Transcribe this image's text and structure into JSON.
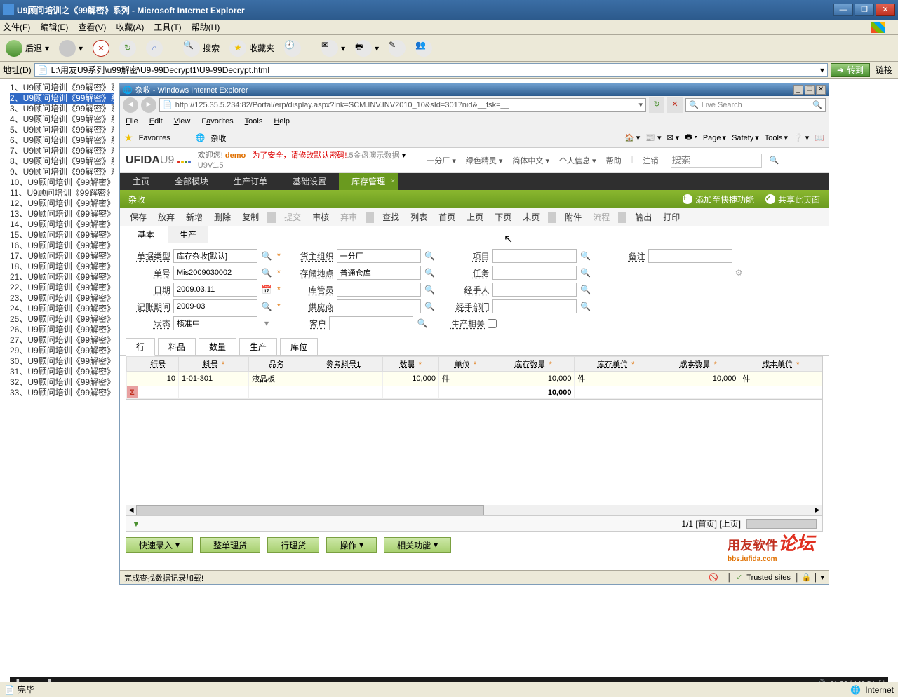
{
  "outer": {
    "title": "U9顾问培训之《99解密》系列 - Microsoft Internet Explorer",
    "menu": [
      "文件(F)",
      "编辑(E)",
      "查看(V)",
      "收藏(A)",
      "工具(T)",
      "帮助(H)"
    ],
    "back": "后退",
    "search": "搜索",
    "favorites": "收藏夹",
    "addr_label": "地址(D)",
    "addr": "L:\\用友U9系列\\u99解密\\U9-99Decrypt1\\U9-99Decrypt.html",
    "go": "转到",
    "links": "链接",
    "status": "完毕",
    "zone": "Internet"
  },
  "sidebar_template": "U9顾问培训《99解密》系",
  "sidebar_nums": [
    1,
    2,
    3,
    4,
    5,
    6,
    7,
    8,
    9,
    10,
    11,
    12,
    13,
    14,
    15,
    16,
    17,
    18,
    21,
    22,
    23,
    24,
    25,
    26,
    27,
    29,
    30,
    31,
    32,
    33
  ],
  "inner": {
    "title": "杂收 - Windows Internet Explorer",
    "url": "http://125.35.5.234:82/Portal/erp/display.aspx?lnk=SCM.INV.INV2010_10&sId=3017nid&__fsk=__",
    "live_search": "Live Search",
    "menu": [
      "File",
      "Edit",
      "View",
      "Favorites",
      "Tools",
      "Help"
    ],
    "fav": "Favorites",
    "fav_tab": "杂收",
    "fav_menus": [
      "Page",
      "Safety",
      "Tools"
    ],
    "status": "完成查找数据记录加载!",
    "trusted": "Trusted sites"
  },
  "app": {
    "logo": "UFIDA",
    "logo2": "U9",
    "welcome": "欢迎您!",
    "user": "demo",
    "version": "U9V1.5",
    "security": "为了安全，请修改默认密码!",
    "datasource": ".5金盘演示数据",
    "header_links": [
      "一分厂",
      "绿色精灵",
      "简体中文",
      "个人信息",
      "帮助",
      "注销"
    ],
    "search_ph": "搜索",
    "nav": [
      "主页",
      "全部模块",
      "生产订单",
      "基础设置",
      "库存管理"
    ],
    "active_nav": 4,
    "page_title": "杂收",
    "quick": "添加至快捷功能",
    "share": "共享此页面",
    "actions": [
      "保存",
      "放弃",
      "新增",
      "删除",
      "复制"
    ],
    "actions_dis": [
      "提交"
    ],
    "actions2": [
      "审核",
      "弃审"
    ],
    "actions3": [
      "查找",
      "列表",
      "首页",
      "上页",
      "下页",
      "末页"
    ],
    "actions4": [
      "附件"
    ],
    "actions4_dis": [
      "流程"
    ],
    "actions5": [
      "输出",
      "打印"
    ],
    "subtabs": [
      "基本",
      "生产"
    ],
    "form": {
      "r1": [
        {
          "label": "单据类型",
          "value": "库存杂收[默认]",
          "mag": true,
          "req": true
        },
        {
          "label": "货主组织",
          "value": "一分厂",
          "mag": true
        },
        {
          "label": "项目",
          "value": "",
          "mag": true
        },
        {
          "label": "备注",
          "value": "",
          "mag": false
        }
      ],
      "r2": [
        {
          "label": "单号",
          "value": "Mis2009030002",
          "mag": true,
          "req": true
        },
        {
          "label": "存储地点",
          "value": "普通仓库",
          "mag": true
        },
        {
          "label": "任务",
          "value": "",
          "mag": true
        },
        {
          "label": "",
          "value": "",
          "icon": true
        }
      ],
      "r3": [
        {
          "label": "日期",
          "value": "2009.03.11",
          "date": true,
          "req": true
        },
        {
          "label": "库管员",
          "value": "",
          "mag": true
        },
        {
          "label": "经手人",
          "value": "",
          "mag": true
        }
      ],
      "r4": [
        {
          "label": "记账期间",
          "value": "2009-03",
          "mag": true,
          "req": true
        },
        {
          "label": "供应商",
          "value": "",
          "mag": true
        },
        {
          "label": "经手部门",
          "value": "",
          "mag": true
        }
      ],
      "r5": [
        {
          "label": "状态",
          "value": "核准中",
          "dd": true
        },
        {
          "label": "客户",
          "value": "",
          "mag": true
        },
        {
          "label": "生产相关",
          "checkbox": true
        }
      ]
    },
    "grid_tabs": [
      "行",
      "料品",
      "数量",
      "生产",
      "库位"
    ],
    "grid_cols": [
      "行号",
      "料号",
      "品名",
      "参考料号1",
      "数量",
      "单位",
      "库存数量",
      "库存单位",
      "成本数量",
      "成本单位"
    ],
    "grid_req": [
      false,
      true,
      false,
      false,
      true,
      true,
      true,
      true,
      true,
      true
    ],
    "grid_row": {
      "no": "10",
      "code": "1-01-301",
      "name": "液晶板",
      "ref": "",
      "qty": "10,000",
      "unit": "件",
      "sqty": "10,000",
      "sunit": "件",
      "cqty": "10,000",
      "cunit": "件"
    },
    "grid_sum": "10,000",
    "pager": "1/1 [首页]  [上页]",
    "btns": [
      "快速录入",
      "整单理货",
      "行理货",
      "操作",
      "相关功能"
    ]
  },
  "scrubber": {
    "time": "01:36 / 142:54"
  },
  "watermark": {
    "top": "用友软件",
    "forum": "论坛",
    "url": "bbs.iufida.com"
  }
}
